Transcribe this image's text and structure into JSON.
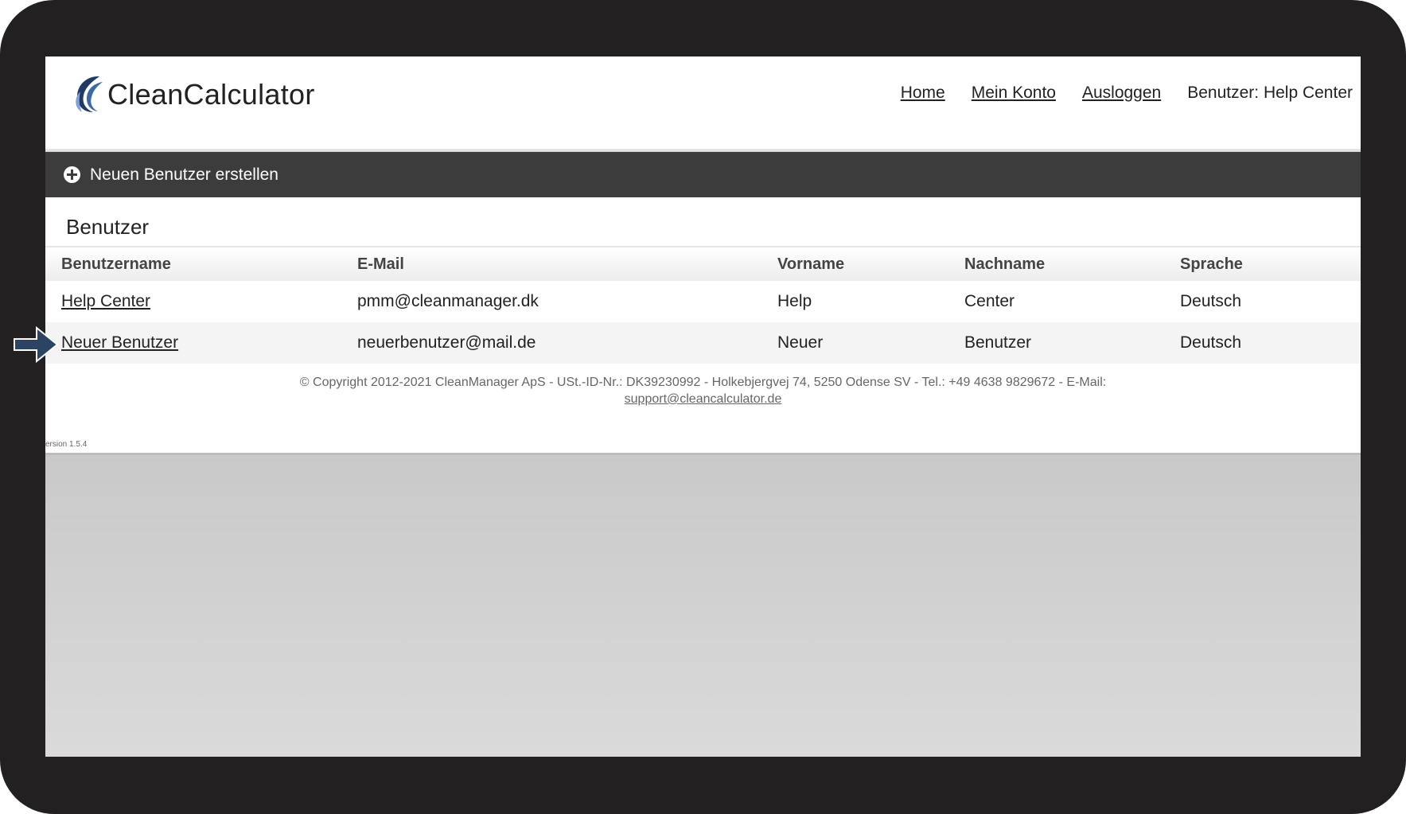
{
  "app": {
    "logo_text": "CleanCalculator"
  },
  "nav": {
    "home": "Home",
    "account": "Mein Konto",
    "logout": "Ausloggen",
    "user": "Benutzer: Help Center"
  },
  "toolbar": {
    "add_label": "Neuen Benutzer erstellen"
  },
  "section": {
    "title": "Benutzer"
  },
  "table": {
    "headers": [
      "Benutzername",
      "E-Mail",
      "Vorname",
      "Nachname",
      "Sprache"
    ],
    "rows": [
      [
        "Help Center",
        "pmm@cleanmanager.dk",
        "Help",
        "Center",
        "Deutsch"
      ],
      [
        "Neuer Benutzer",
        "neuerbenutzer@mail.de",
        "Neuer",
        "Benutzer",
        "Deutsch"
      ]
    ]
  },
  "footer": {
    "copyright": "© Copyright 2012-2021 CleanManager ApS - USt.-ID-Nr.: DK39230992 - Holkebjergvej 74, 5250 Odense SV - Tel.: +49 4638 9829672 - E-Mail:",
    "email": "support@cleancalculator.de",
    "version": "ersion 1.5.4"
  },
  "colors": {
    "frame": "#222021",
    "toolbar": "#3c3c3c",
    "arrow": "#2c4463",
    "logo_blue": "#3b6aa8"
  }
}
